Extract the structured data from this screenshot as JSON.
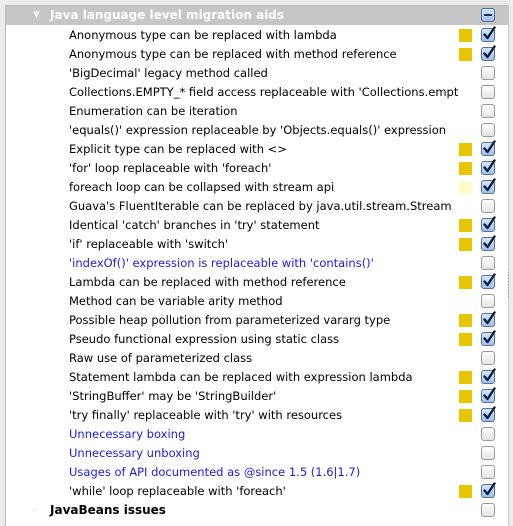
{
  "colors": {
    "severity_warning": "#e9c500",
    "severity_weak": "#fdfbcc",
    "link_blue": "#1a1ae6",
    "group_header_bg": "#c6c6c6"
  },
  "group": {
    "label": "Java language level migration aids",
    "expanded": true,
    "state": "mixed",
    "arrow_icon": "triangle-down-icon"
  },
  "items": [
    {
      "label": "Anonymous type can be replaced with lambda",
      "severity": "warning",
      "checked": true,
      "style": "normal"
    },
    {
      "label": "Anonymous type can be replaced with method reference",
      "severity": "warning",
      "checked": true,
      "style": "normal"
    },
    {
      "label": "'BigDecimal' legacy method called",
      "severity": "none",
      "checked": false,
      "style": "normal"
    },
    {
      "label": "Collections.EMPTY_* field access replaceable with 'Collections.empt",
      "severity": "none",
      "checked": false,
      "style": "normal"
    },
    {
      "label": "Enumeration can be iteration",
      "severity": "none",
      "checked": false,
      "style": "normal"
    },
    {
      "label": "'equals()' expression replaceable by 'Objects.equals()' expression",
      "severity": "none",
      "checked": false,
      "style": "normal"
    },
    {
      "label": "Explicit type can be replaced with <>",
      "severity": "warning",
      "checked": true,
      "style": "normal"
    },
    {
      "label": "'for' loop replaceable with 'foreach'",
      "severity": "warning",
      "checked": true,
      "style": "normal"
    },
    {
      "label": "foreach loop can be collapsed with stream api",
      "severity": "weak",
      "checked": true,
      "style": "normal"
    },
    {
      "label": "Guava's FluentIterable can be replaced by java.util.stream.Stream",
      "severity": "none",
      "checked": false,
      "style": "normal"
    },
    {
      "label": "Identical 'catch' branches in 'try' statement",
      "severity": "warning",
      "checked": true,
      "style": "normal"
    },
    {
      "label": "'if' replaceable with 'switch'",
      "severity": "warning",
      "checked": true,
      "style": "normal"
    },
    {
      "label": "'indexOf()' expression is replaceable with 'contains()'",
      "severity": "none",
      "checked": false,
      "style": "blue"
    },
    {
      "label": "Lambda can be replaced with method reference",
      "severity": "warning",
      "checked": true,
      "style": "normal"
    },
    {
      "label": "Method can be variable arity method",
      "severity": "none",
      "checked": false,
      "style": "normal"
    },
    {
      "label": "Possible heap pollution from parameterized vararg type",
      "severity": "warning",
      "checked": true,
      "style": "normal"
    },
    {
      "label": "Pseudo functional expression using static class",
      "severity": "warning",
      "checked": true,
      "style": "normal"
    },
    {
      "label": "Raw use of parameterized class",
      "severity": "none",
      "checked": false,
      "style": "normal"
    },
    {
      "label": "Statement lambda can be replaced with expression lambda",
      "severity": "warning",
      "checked": true,
      "style": "normal"
    },
    {
      "label": "'StringBuffer' may be 'StringBuilder'",
      "severity": "warning",
      "checked": true,
      "style": "normal"
    },
    {
      "label": "'try finally' replaceable with 'try' with resources",
      "severity": "warning",
      "checked": true,
      "style": "normal"
    },
    {
      "label": "Unnecessary boxing",
      "severity": "none",
      "checked": false,
      "style": "blue"
    },
    {
      "label": "Unnecessary unboxing",
      "severity": "none",
      "checked": false,
      "style": "blue"
    },
    {
      "label": "Usages of API documented as @since 1.5 (1.6|1.7)",
      "severity": "none",
      "checked": false,
      "style": "blue"
    },
    {
      "label": "'while' loop replaceable with 'foreach'",
      "severity": "warning",
      "checked": true,
      "style": "normal"
    }
  ],
  "next_group": {
    "label": "JavaBeans issues",
    "expanded": false,
    "checked": false,
    "arrow_icon": "triangle-right-icon"
  }
}
